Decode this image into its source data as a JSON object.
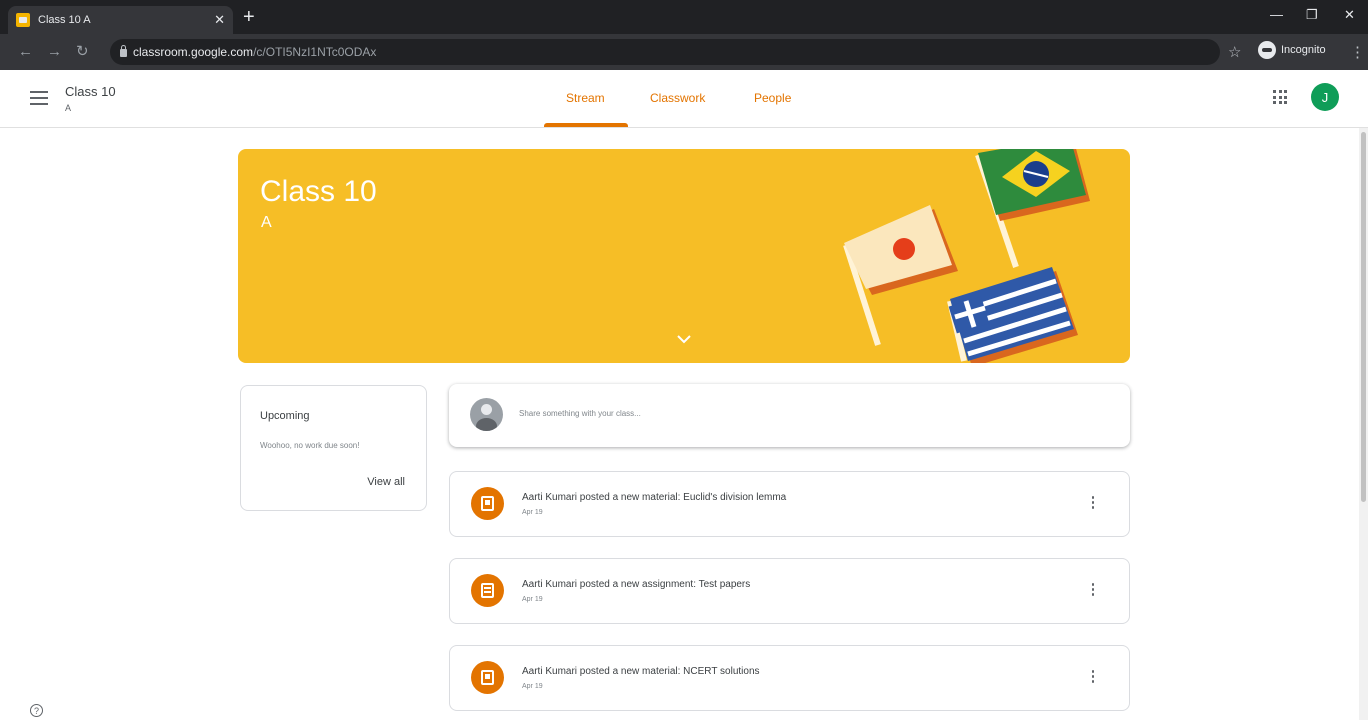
{
  "browser": {
    "tab_title": "Class 10 A",
    "tab_close": "✕",
    "new_tab": "+",
    "url_host": "classroom.google.com",
    "url_path": "/c/OTI5NzI1NTc0ODAx",
    "profile_label": "Incognito",
    "minimize": "—",
    "maximize": "❐",
    "close": "✕"
  },
  "header": {
    "class_name": "Class 10",
    "section": "A",
    "tabs": [
      {
        "label": "Stream",
        "active": true
      },
      {
        "label": "Classwork",
        "active": false
      },
      {
        "label": "People",
        "active": false
      }
    ],
    "user_initial": "J"
  },
  "banner": {
    "title": "Class 10",
    "section": "A",
    "color": "#f6be26"
  },
  "upcoming": {
    "title": "Upcoming",
    "message": "Woohoo, no work due soon!",
    "link": "View all"
  },
  "share": {
    "placeholder": "Share something with your class..."
  },
  "posts": [
    {
      "type": "material",
      "text": "Aarti Kumari posted a new material: Euclid's division lemma",
      "date": "Apr 19"
    },
    {
      "type": "assignment",
      "text": "Aarti Kumari posted a new assignment: Test papers",
      "date": "Apr 19"
    },
    {
      "type": "material",
      "text": "Aarti Kumari posted a new material: NCERT solutions",
      "date": "Apr 19"
    }
  ],
  "colors": {
    "accent": "#e37400",
    "avatar": "#0f9d58"
  }
}
